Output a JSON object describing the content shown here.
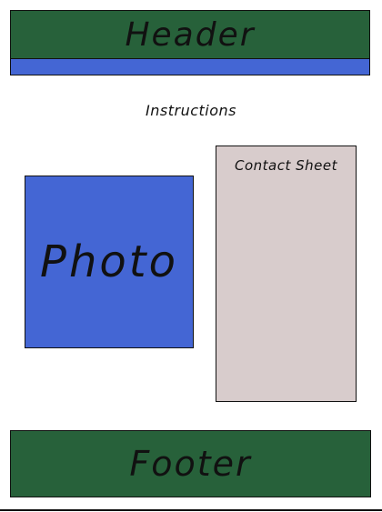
{
  "layout": {
    "header_label": "Header",
    "instructions_label": "Instructions",
    "photo_label": "Photo",
    "contact_sheet_label": "Contact Sheet",
    "footer_label": "Footer"
  },
  "colors": {
    "header_footer": "#27613a",
    "photo_and_strip": "#4466d4",
    "contact_sheet": "#d8cccc"
  }
}
